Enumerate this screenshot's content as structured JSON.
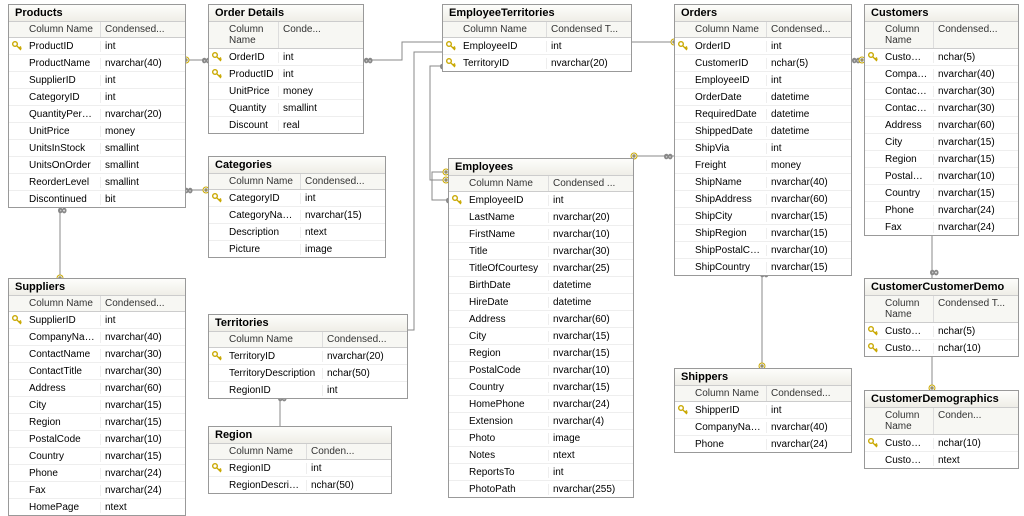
{
  "headers": {
    "col_name": "Column Name",
    "col_type_full": "Condensed Type",
    "col_type_short": "Condensed...",
    "col_type_shorter": "Condensed ...",
    "col_type_tiny": "Conde...",
    "col_type_tiny2": "Conden...",
    "col_type_t": "Condensed T..."
  },
  "tables": {
    "products": {
      "title": "Products",
      "header_type": "col_type_short",
      "cols": [
        {
          "pk": true,
          "name": "ProductID",
          "type": "int"
        },
        {
          "pk": false,
          "name": "ProductName",
          "type": "nvarchar(40)"
        },
        {
          "pk": false,
          "name": "SupplierID",
          "type": "int"
        },
        {
          "pk": false,
          "name": "CategoryID",
          "type": "int"
        },
        {
          "pk": false,
          "name": "QuantityPerUnit",
          "type": "nvarchar(20)"
        },
        {
          "pk": false,
          "name": "UnitPrice",
          "type": "money"
        },
        {
          "pk": false,
          "name": "UnitsInStock",
          "type": "smallint"
        },
        {
          "pk": false,
          "name": "UnitsOnOrder",
          "type": "smallint"
        },
        {
          "pk": false,
          "name": "ReorderLevel",
          "type": "smallint"
        },
        {
          "pk": false,
          "name": "Discontinued",
          "type": "bit"
        }
      ]
    },
    "order_details": {
      "title": "Order Details",
      "header_type": "col_type_tiny",
      "cols": [
        {
          "pk": true,
          "name": "OrderID",
          "type": "int"
        },
        {
          "pk": true,
          "name": "ProductID",
          "type": "int"
        },
        {
          "pk": false,
          "name": "UnitPrice",
          "type": "money"
        },
        {
          "pk": false,
          "name": "Quantity",
          "type": "smallint"
        },
        {
          "pk": false,
          "name": "Discount",
          "type": "real"
        }
      ]
    },
    "employee_territories": {
      "title": "EmployeeTerritories",
      "header_type": "col_type_t",
      "cols": [
        {
          "pk": true,
          "name": "EmployeeID",
          "type": "int"
        },
        {
          "pk": true,
          "name": "TerritoryID",
          "type": "nvarchar(20)"
        }
      ]
    },
    "orders": {
      "title": "Orders",
      "header_type": "col_type_short",
      "cols": [
        {
          "pk": true,
          "name": "OrderID",
          "type": "int"
        },
        {
          "pk": false,
          "name": "CustomerID",
          "type": "nchar(5)"
        },
        {
          "pk": false,
          "name": "EmployeeID",
          "type": "int"
        },
        {
          "pk": false,
          "name": "OrderDate",
          "type": "datetime"
        },
        {
          "pk": false,
          "name": "RequiredDate",
          "type": "datetime"
        },
        {
          "pk": false,
          "name": "ShippedDate",
          "type": "datetime"
        },
        {
          "pk": false,
          "name": "ShipVia",
          "type": "int"
        },
        {
          "pk": false,
          "name": "Freight",
          "type": "money"
        },
        {
          "pk": false,
          "name": "ShipName",
          "type": "nvarchar(40)"
        },
        {
          "pk": false,
          "name": "ShipAddress",
          "type": "nvarchar(60)"
        },
        {
          "pk": false,
          "name": "ShipCity",
          "type": "nvarchar(15)"
        },
        {
          "pk": false,
          "name": "ShipRegion",
          "type": "nvarchar(15)"
        },
        {
          "pk": false,
          "name": "ShipPostalCode",
          "type": "nvarchar(10)"
        },
        {
          "pk": false,
          "name": "ShipCountry",
          "type": "nvarchar(15)"
        }
      ]
    },
    "customers": {
      "title": "Customers",
      "header_type": "col_type_short",
      "cols": [
        {
          "pk": true,
          "name": "CustomerID",
          "type": "nchar(5)"
        },
        {
          "pk": false,
          "name": "CompanyName",
          "type": "nvarchar(40)"
        },
        {
          "pk": false,
          "name": "ContactName",
          "type": "nvarchar(30)"
        },
        {
          "pk": false,
          "name": "ContactTitle",
          "type": "nvarchar(30)"
        },
        {
          "pk": false,
          "name": "Address",
          "type": "nvarchar(60)"
        },
        {
          "pk": false,
          "name": "City",
          "type": "nvarchar(15)"
        },
        {
          "pk": false,
          "name": "Region",
          "type": "nvarchar(15)"
        },
        {
          "pk": false,
          "name": "PostalCode",
          "type": "nvarchar(10)"
        },
        {
          "pk": false,
          "name": "Country",
          "type": "nvarchar(15)"
        },
        {
          "pk": false,
          "name": "Phone",
          "type": "nvarchar(24)"
        },
        {
          "pk": false,
          "name": "Fax",
          "type": "nvarchar(24)"
        }
      ]
    },
    "categories": {
      "title": "Categories",
      "header_type": "col_type_short",
      "cols": [
        {
          "pk": true,
          "name": "CategoryID",
          "type": "int"
        },
        {
          "pk": false,
          "name": "CategoryName",
          "type": "nvarchar(15)"
        },
        {
          "pk": false,
          "name": "Description",
          "type": "ntext"
        },
        {
          "pk": false,
          "name": "Picture",
          "type": "image"
        }
      ]
    },
    "suppliers": {
      "title": "Suppliers",
      "header_type": "col_type_short",
      "cols": [
        {
          "pk": true,
          "name": "SupplierID",
          "type": "int"
        },
        {
          "pk": false,
          "name": "CompanyName",
          "type": "nvarchar(40)"
        },
        {
          "pk": false,
          "name": "ContactName",
          "type": "nvarchar(30)"
        },
        {
          "pk": false,
          "name": "ContactTitle",
          "type": "nvarchar(30)"
        },
        {
          "pk": false,
          "name": "Address",
          "type": "nvarchar(60)"
        },
        {
          "pk": false,
          "name": "City",
          "type": "nvarchar(15)"
        },
        {
          "pk": false,
          "name": "Region",
          "type": "nvarchar(15)"
        },
        {
          "pk": false,
          "name": "PostalCode",
          "type": "nvarchar(10)"
        },
        {
          "pk": false,
          "name": "Country",
          "type": "nvarchar(15)"
        },
        {
          "pk": false,
          "name": "Phone",
          "type": "nvarchar(24)"
        },
        {
          "pk": false,
          "name": "Fax",
          "type": "nvarchar(24)"
        },
        {
          "pk": false,
          "name": "HomePage",
          "type": "ntext"
        }
      ]
    },
    "territories": {
      "title": "Territories",
      "header_type": "col_type_short",
      "cols": [
        {
          "pk": true,
          "name": "TerritoryID",
          "type": "nvarchar(20)"
        },
        {
          "pk": false,
          "name": "TerritoryDescription",
          "type": "nchar(50)"
        },
        {
          "pk": false,
          "name": "RegionID",
          "type": "int"
        }
      ]
    },
    "region": {
      "title": "Region",
      "header_type": "col_type_tiny2",
      "cols": [
        {
          "pk": true,
          "name": "RegionID",
          "type": "int"
        },
        {
          "pk": false,
          "name": "RegionDescription",
          "type": "nchar(50)"
        }
      ]
    },
    "employees": {
      "title": "Employees",
      "header_type": "col_type_shorter",
      "cols": [
        {
          "pk": true,
          "name": "EmployeeID",
          "type": "int"
        },
        {
          "pk": false,
          "name": "LastName",
          "type": "nvarchar(20)"
        },
        {
          "pk": false,
          "name": "FirstName",
          "type": "nvarchar(10)"
        },
        {
          "pk": false,
          "name": "Title",
          "type": "nvarchar(30)"
        },
        {
          "pk": false,
          "name": "TitleOfCourtesy",
          "type": "nvarchar(25)"
        },
        {
          "pk": false,
          "name": "BirthDate",
          "type": "datetime"
        },
        {
          "pk": false,
          "name": "HireDate",
          "type": "datetime"
        },
        {
          "pk": false,
          "name": "Address",
          "type": "nvarchar(60)"
        },
        {
          "pk": false,
          "name": "City",
          "type": "nvarchar(15)"
        },
        {
          "pk": false,
          "name": "Region",
          "type": "nvarchar(15)"
        },
        {
          "pk": false,
          "name": "PostalCode",
          "type": "nvarchar(10)"
        },
        {
          "pk": false,
          "name": "Country",
          "type": "nvarchar(15)"
        },
        {
          "pk": false,
          "name": "HomePhone",
          "type": "nvarchar(24)"
        },
        {
          "pk": false,
          "name": "Extension",
          "type": "nvarchar(4)"
        },
        {
          "pk": false,
          "name": "Photo",
          "type": "image"
        },
        {
          "pk": false,
          "name": "Notes",
          "type": "ntext"
        },
        {
          "pk": false,
          "name": "ReportsTo",
          "type": "int"
        },
        {
          "pk": false,
          "name": "PhotoPath",
          "type": "nvarchar(255)"
        }
      ]
    },
    "shippers": {
      "title": "Shippers",
      "header_type": "col_type_short",
      "cols": [
        {
          "pk": true,
          "name": "ShipperID",
          "type": "int"
        },
        {
          "pk": false,
          "name": "CompanyName",
          "type": "nvarchar(40)"
        },
        {
          "pk": false,
          "name": "Phone",
          "type": "nvarchar(24)"
        }
      ]
    },
    "customer_customer_demo": {
      "title": "CustomerCustomerDemo",
      "header_type": "col_type_t",
      "cols": [
        {
          "pk": true,
          "name": "CustomerID",
          "type": "nchar(5)"
        },
        {
          "pk": true,
          "name": "Customer...",
          "type": "nchar(10)"
        }
      ]
    },
    "customer_demographics": {
      "title": "CustomerDemographics",
      "header_type": "col_type_tiny2",
      "cols": [
        {
          "pk": true,
          "name": "CustomerTypeID",
          "type": "nchar(10)"
        },
        {
          "pk": false,
          "name": "CustomerDesc",
          "type": "ntext"
        }
      ]
    }
  }
}
